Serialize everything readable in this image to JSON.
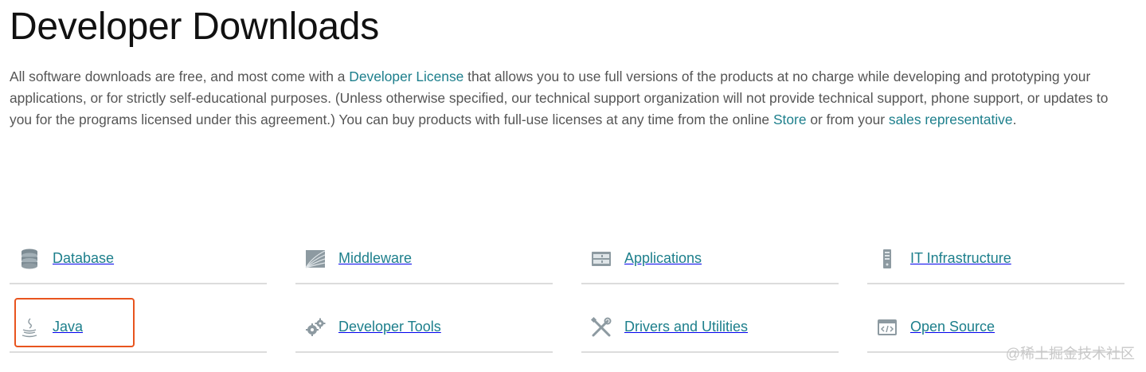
{
  "header": {
    "title": "Developer Downloads"
  },
  "intro": {
    "part1": "All software downloads are free, and most come with a ",
    "link_license": "Developer License",
    "part2": " that allows you to use full versions of the products at no charge while developing and prototyping your applications, or for strictly self-educational purposes. (Unless otherwise specified, our technical support organization will not provide technical support, phone support, or updates to you for the programs licensed under this agreement.) You can buy products with full-use licenses at any time from the online ",
    "link_store": "Store",
    "part3": " or from your ",
    "link_sales": "sales representative",
    "part4": "."
  },
  "categories": [
    {
      "label": "Database",
      "icon": "database-icon"
    },
    {
      "label": "Middleware",
      "icon": "middleware-icon"
    },
    {
      "label": "Applications",
      "icon": "applications-icon"
    },
    {
      "label": "IT Infrastructure",
      "icon": "server-icon"
    },
    {
      "label": "Java",
      "icon": "java-cup-icon"
    },
    {
      "label": "Developer Tools",
      "icon": "gears-icon"
    },
    {
      "label": "Drivers and Utilities",
      "icon": "tools-icon"
    },
    {
      "label": "Open Source",
      "icon": "code-window-icon"
    }
  ],
  "watermark": "@稀土掘金技术社区",
  "colors": {
    "link": "#1d7f8c",
    "highlight": "#e8541e",
    "divider": "#dcdcdc"
  }
}
